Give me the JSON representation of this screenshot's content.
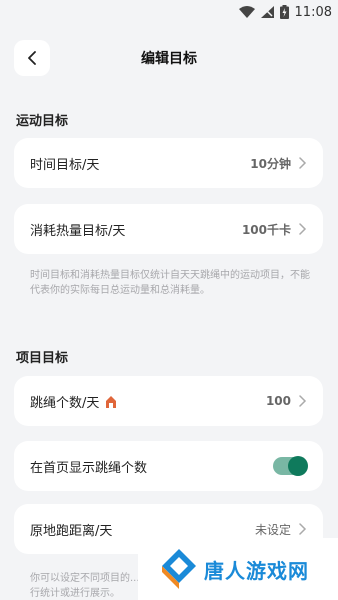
{
  "status_bar": {
    "time": "11:08"
  },
  "header": {
    "title": "编辑目标"
  },
  "exercise_section": {
    "title": "运动目标"
  },
  "time_goal": {
    "label": "时间目标/天",
    "value": "10分钟"
  },
  "calorie_goal": {
    "label": "消耗热量目标/天",
    "value": "100千卡"
  },
  "exercise_note": "时间目标和消耗热量目标仅统计自天天跳绳中的运动项目，不能代表你的实际每日总运动量和总消耗量。",
  "project_section": {
    "title": "项目目标"
  },
  "jump_count": {
    "label": "跳绳个数/天",
    "value": "100"
  },
  "show_on_home": {
    "label": "在首页显示跳绳个数",
    "enabled": true
  },
  "run_distance": {
    "label": "原地跑距离/天",
    "value": "未设定"
  },
  "bottom_note": "你可以设定不同项目的...进行统计或进行展示。",
  "watermark": {
    "text": "唐人游戏网"
  },
  "colors": {
    "accent": "#0f7a5c",
    "toggle_track": "#79b7a4",
    "fire": "#e0663a"
  }
}
